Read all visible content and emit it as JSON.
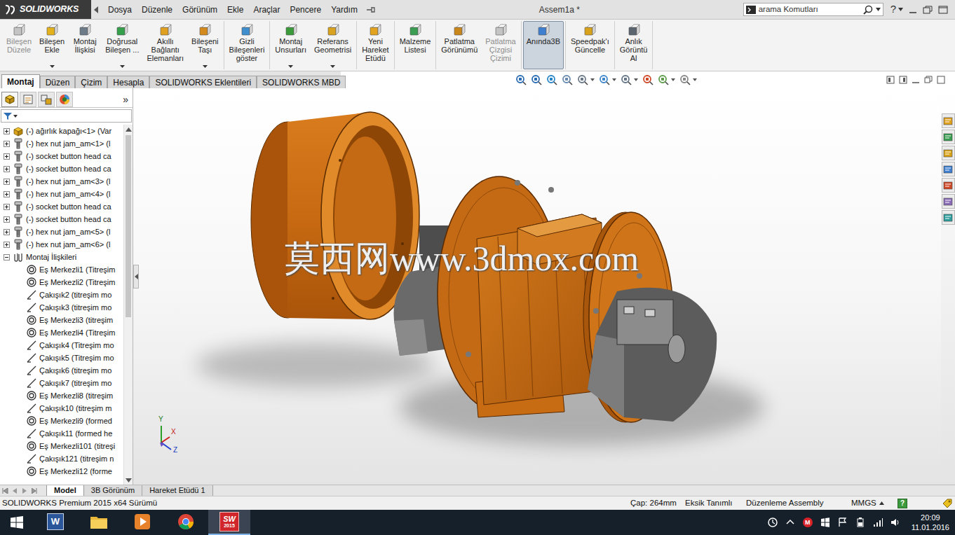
{
  "app": {
    "logo": "SOLIDWORKS"
  },
  "menu": [
    "Dosya",
    "Düzenle",
    "Görünüm",
    "Ekle",
    "Araçlar",
    "Pencere",
    "Yardım"
  ],
  "window": {
    "title": "Assem1a *",
    "help": "?"
  },
  "search": {
    "placeholder": "arama Komutları"
  },
  "ribbon": [
    {
      "buttons": [
        {
          "label": "Bileşen\nDüzele",
          "disabled": true,
          "selected": false,
          "dropdown": false
        },
        {
          "label": "Bileşen\nEkle",
          "disabled": false,
          "selected": false,
          "dropdown": true
        },
        {
          "label": "Montaj\nİlişkisi",
          "disabled": false,
          "selected": false,
          "dropdown": false
        },
        {
          "label": "Doğrusal\nBileşen ...",
          "disabled": false,
          "selected": false,
          "dropdown": true
        },
        {
          "label": "Akıllı\nBağlantı\nElemanları",
          "disabled": false,
          "selected": false,
          "dropdown": false
        },
        {
          "label": "Bileşeni\nTaşı",
          "disabled": false,
          "selected": false,
          "dropdown": true
        }
      ]
    },
    {
      "buttons": [
        {
          "label": "Gizli\nBileşenleri\ngöster",
          "disabled": false,
          "selected": false,
          "dropdown": false
        }
      ]
    },
    {
      "buttons": [
        {
          "label": "Montaj\nUnsurları",
          "disabled": false,
          "selected": false,
          "dropdown": true
        },
        {
          "label": "Referans\nGeometrisi",
          "disabled": false,
          "selected": false,
          "dropdown": true
        }
      ]
    },
    {
      "buttons": [
        {
          "label": "Yeni\nHareket\nEtüdü",
          "disabled": false,
          "selected": false,
          "dropdown": false
        }
      ]
    },
    {
      "buttons": [
        {
          "label": "Malzeme\nListesi",
          "disabled": false,
          "selected": false,
          "dropdown": false
        }
      ]
    },
    {
      "buttons": [
        {
          "label": "Patlatma\nGörünümü",
          "disabled": false,
          "selected": false,
          "dropdown": false
        },
        {
          "label": "Patlatma\nÇizgisi\nÇizimi",
          "disabled": true,
          "selected": false,
          "dropdown": false
        }
      ]
    },
    {
      "buttons": [
        {
          "label": "Anında3B",
          "disabled": false,
          "selected": true,
          "dropdown": false
        }
      ]
    },
    {
      "buttons": [
        {
          "label": "Speedpak'ı\nGüncelle",
          "disabled": false,
          "selected": false,
          "dropdown": false
        }
      ]
    },
    {
      "buttons": [
        {
          "label": "Anlık\nGörüntü\nAl",
          "disabled": false,
          "selected": false,
          "dropdown": false
        }
      ]
    }
  ],
  "command_tabs": [
    {
      "label": "Montaj",
      "selected": true
    },
    {
      "label": "Düzen",
      "selected": false
    },
    {
      "label": "Çizim",
      "selected": false
    },
    {
      "label": "Hesapla",
      "selected": false
    },
    {
      "label": "SOLIDWORKS Eklentileri",
      "selected": false
    },
    {
      "label": "SOLIDWORKS MBD",
      "selected": false
    }
  ],
  "panel": {
    "more": "»"
  },
  "tree": [
    {
      "label": "(-) ağırlık kapağı<1> (Var",
      "kind": "assembly",
      "expanded": false
    },
    {
      "label": "(-) hex nut jam_am<1> (l",
      "kind": "part",
      "expanded": false
    },
    {
      "label": "(-) socket button head ca",
      "kind": "part",
      "expanded": false
    },
    {
      "label": "(-) socket button head ca",
      "kind": "part",
      "expanded": false
    },
    {
      "label": "(-) hex nut jam_am<3> (l",
      "kind": "part",
      "expanded": false
    },
    {
      "label": "(-) hex nut jam_am<4> (l",
      "kind": "part",
      "expanded": false
    },
    {
      "label": "(-) socket button head ca",
      "kind": "part",
      "expanded": false
    },
    {
      "label": "(-) socket button head ca",
      "kind": "part",
      "expanded": false
    },
    {
      "label": "(-) hex nut jam_am<5> (l",
      "kind": "part",
      "expanded": false
    },
    {
      "label": "(-) hex nut jam_am<6> (l",
      "kind": "part",
      "expanded": false
    },
    {
      "label": "Montaj İlişkileri",
      "kind": "mates",
      "expanded": true
    },
    {
      "label": "Eş Merkezli1 (Titreşim",
      "kind": "concentric",
      "expanded": null
    },
    {
      "label": "Eş Merkezli2 (Titreşim",
      "kind": "concentric",
      "expanded": null
    },
    {
      "label": "Çakışık2 (titreşim mo",
      "kind": "coincident",
      "expanded": null
    },
    {
      "label": "Çakışık3 (titreşim mo",
      "kind": "coincident",
      "expanded": null
    },
    {
      "label": "Eş Merkezli3 (titreşim",
      "kind": "concentric",
      "expanded": null
    },
    {
      "label": "Eş Merkezli4 (Titreşim",
      "kind": "concentric",
      "expanded": null
    },
    {
      "label": "Çakışık4 (Titreşim mo",
      "kind": "coincident",
      "expanded": null
    },
    {
      "label": "Çakışık5 (Titreşim mo",
      "kind": "coincident",
      "expanded": null
    },
    {
      "label": "Çakışık6 (titreşim mo",
      "kind": "coincident",
      "expanded": null
    },
    {
      "label": "Çakışık7 (titreşim mo",
      "kind": "coincident",
      "expanded": null
    },
    {
      "label": "Eş Merkezli8 (titreşim",
      "kind": "concentric",
      "expanded": null
    },
    {
      "label": "Çakışık10 (titreşim m",
      "kind": "coincident",
      "expanded": null
    },
    {
      "label": "Eş Merkezli9 (formed",
      "kind": "concentric",
      "expanded": null
    },
    {
      "label": "Çakışık11 (formed he",
      "kind": "coincident",
      "expanded": null
    },
    {
      "label": "Eş Merkezli101 (titreşi",
      "kind": "concentric",
      "expanded": null
    },
    {
      "label": "Çakışık121 (titreşim n",
      "kind": "coincident",
      "expanded": null
    },
    {
      "label": "Eş Merkezli12 (forme",
      "kind": "concentric",
      "expanded": null
    }
  ],
  "viewport": {
    "watermark": "莫西网www.3dmox.com",
    "axes": [
      "Y",
      "X",
      "Z"
    ]
  },
  "view_tabs": [
    {
      "label": "Model",
      "selected": true
    },
    {
      "label": "3B Görünüm",
      "selected": false
    },
    {
      "label": "Hareket Etüdü 1",
      "selected": false
    }
  ],
  "status_bar": {
    "version": "SOLIDWORKS Premium 2015 x64 Sürümü",
    "fields": [
      "Çap: 264mm",
      "Eksik Tanımlı",
      "Düzenleme Assembly"
    ],
    "units": "MMGS",
    "help": "?"
  },
  "taskbar": {
    "apps": [
      {
        "kind": "word",
        "active": false,
        "badge": "W",
        "badge_sub": ""
      },
      {
        "kind": "explorer",
        "active": false,
        "badge": "",
        "badge_sub": ""
      },
      {
        "kind": "media",
        "active": false,
        "badge": "",
        "badge_sub": ""
      },
      {
        "kind": "chrome",
        "active": false,
        "badge": "",
        "badge_sub": ""
      },
      {
        "kind": "solidworks",
        "active": true,
        "badge": "SW",
        "badge_sub": "2015"
      }
    ],
    "tray": [
      {
        "kind": "sync",
        "badge": ""
      },
      {
        "kind": "chevron",
        "badge": ""
      },
      {
        "kind": "mapp",
        "badge": "M"
      },
      {
        "kind": "windows",
        "badge": ""
      },
      {
        "kind": "flag",
        "badge": ""
      },
      {
        "kind": "battery",
        "badge": ""
      },
      {
        "kind": "network",
        "badge": ""
      },
      {
        "kind": "volume",
        "badge": ""
      }
    ],
    "time": "20:09",
    "date": "11.01.2016"
  }
}
